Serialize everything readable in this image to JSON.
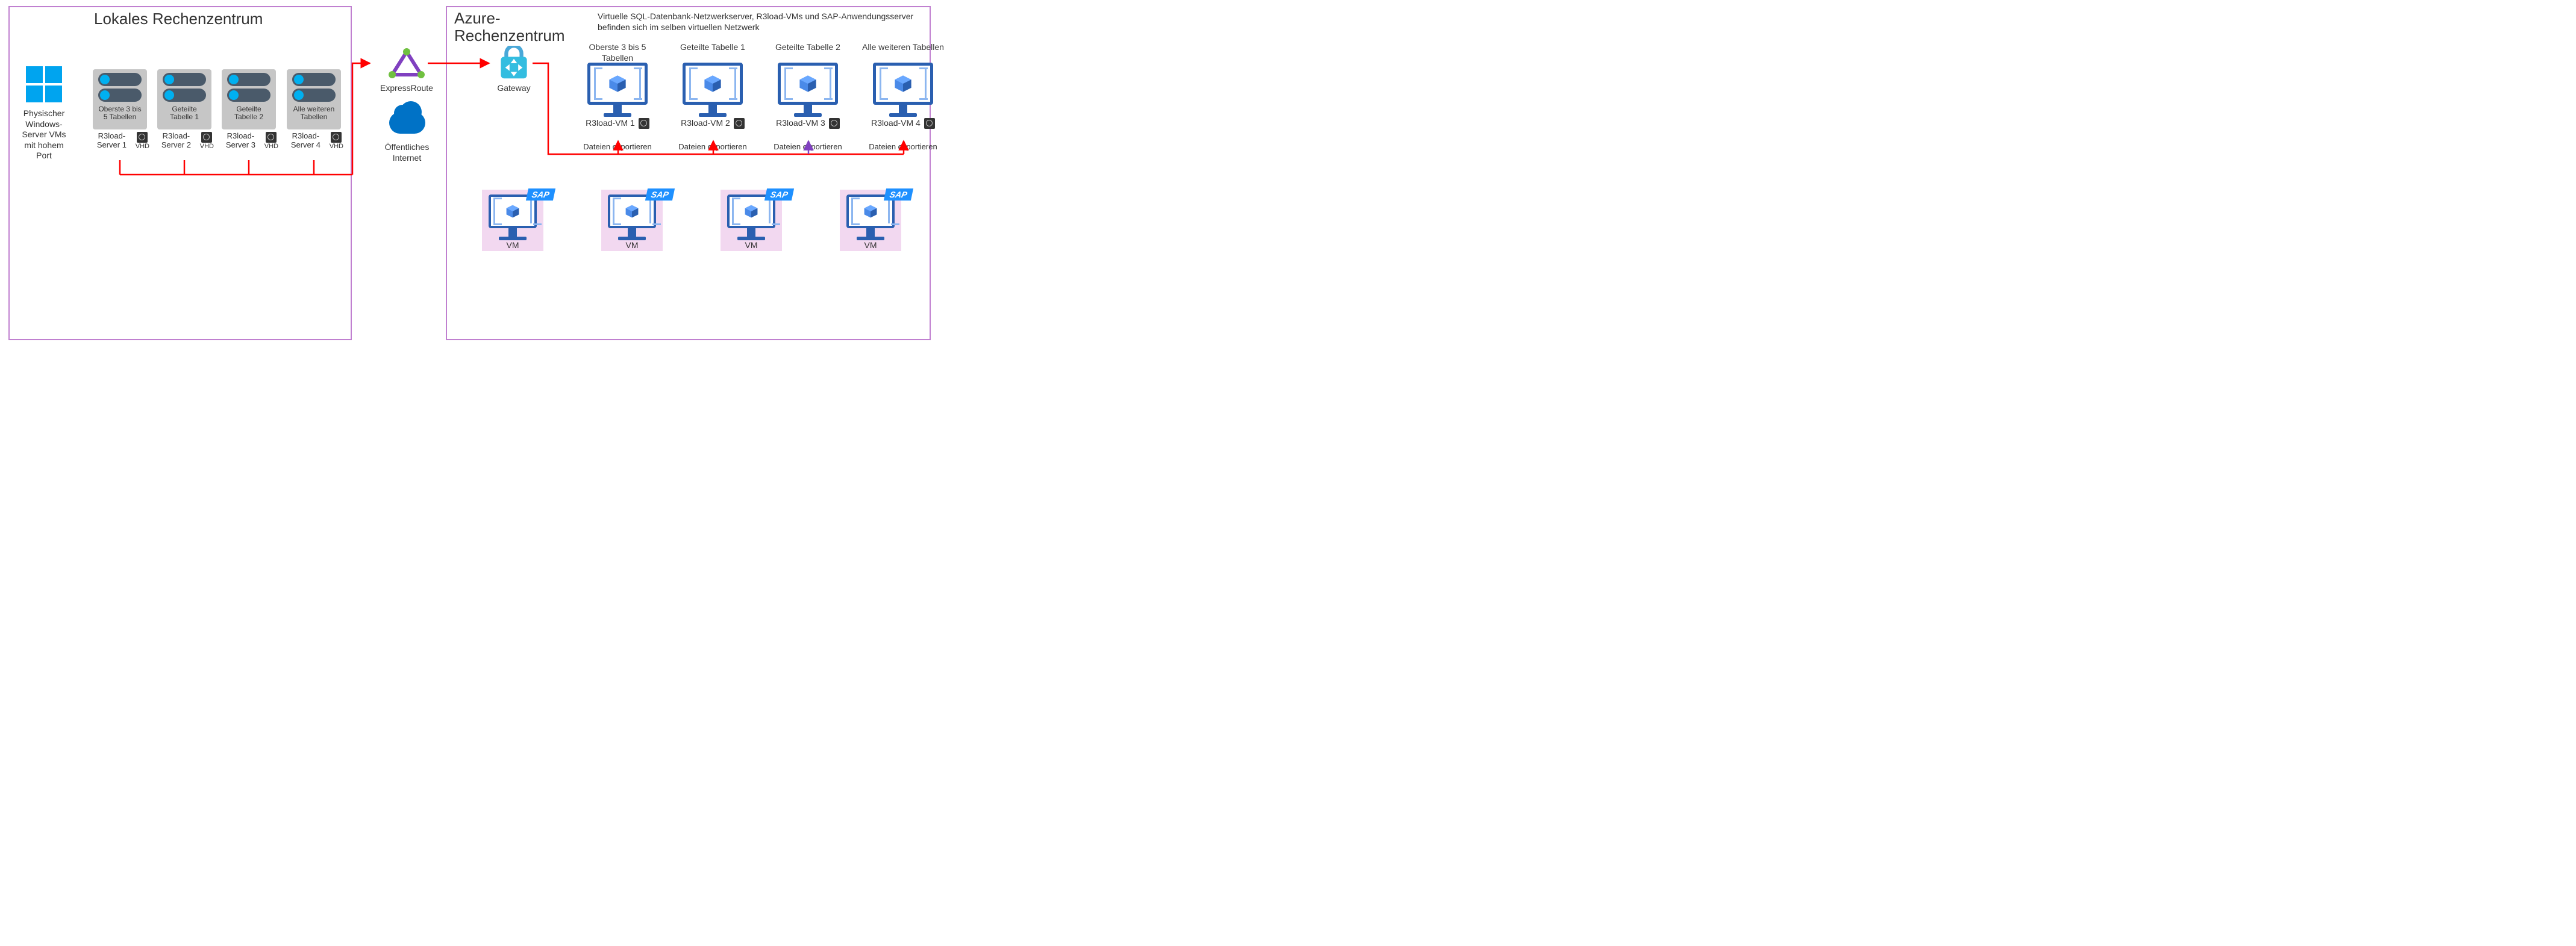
{
  "local": {
    "title": "Lokales Rechenzentrum",
    "windows_caption": "Physischer Windows-Server VMs mit hohem Port",
    "servers": [
      {
        "box": "Oberste 3 bis 5 Tabellen",
        "name": "R3load-Server 1",
        "disk": "VHD"
      },
      {
        "box": "Geteilte Tabelle 1",
        "name": "R3load-Server 2",
        "disk": "VHD"
      },
      {
        "box": "Geteilte Tabelle 2",
        "name": "R3load-Server 3",
        "disk": "VHD"
      },
      {
        "box": "Alle weiteren Tabellen",
        "name": "R3load-Server 4",
        "disk": "VHD"
      }
    ]
  },
  "middle": {
    "expressroute": "ExpressRoute",
    "internet": "Öffentliches Internet"
  },
  "azure": {
    "title": "Azure-Rechenzentrum",
    "note": "Virtuelle SQL-Datenbank-Netzwerkserver, R3load-VMs und SAP-Anwendungsserver befinden sich im selben virtuellen Netzwerk",
    "gateway": "Gateway",
    "r3vms": [
      {
        "top": "Oberste 3 bis 5 Tabellen",
        "name": "R3load-VM 1",
        "export": "Dateien exportieren"
      },
      {
        "top": "Geteilte Tabelle 1",
        "name": "R3load-VM 2",
        "export": "Dateien exportieren"
      },
      {
        "top": "Geteilte Tabelle 2",
        "name": "R3load-VM 3",
        "export": "Dateien exportieren"
      },
      {
        "top": "Alle weiteren Tabellen",
        "name": "R3load-VM 4",
        "export": "Dateien exportieren"
      }
    ],
    "sap_vm_label": "VM",
    "sap_badge": "SAP",
    "disk": "●"
  }
}
